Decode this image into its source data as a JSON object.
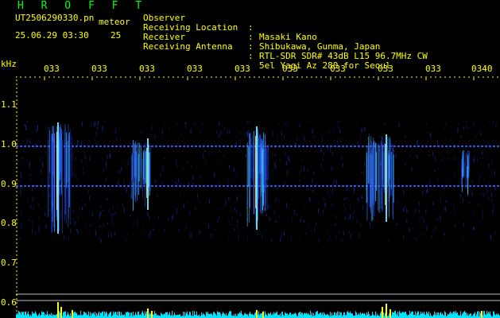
{
  "header": {
    "app_name": "H R O F F T",
    "filename": "UT2506290330.pn",
    "mode_label": "meteor",
    "datetime": "25.06.29 03:30",
    "count": "25"
  },
  "info": [
    {
      "label": "Observer",
      "sep": ":",
      "value": "Masaki Kano"
    },
    {
      "label": "Receiving Location",
      "sep": ":",
      "value": "Shibukawa, Gunma, Japan"
    },
    {
      "label": "Receiver",
      "sep": ":",
      "value": "RTL-SDR SDR# 43dB L15 96.7MHz CW"
    },
    {
      "label": "Receiving Antenna",
      "sep": ":",
      "value": "5el Yagi Az 280 for Seoul"
    }
  ],
  "y_axis": {
    "unit": "kHz",
    "ticks": [
      "1.1",
      "1.0",
      "0.9",
      "0.8",
      "0.7",
      "0.6"
    ]
  },
  "x_axis": {
    "ticks": [
      "033",
      "033",
      "033",
      "033",
      "033",
      "033",
      "033",
      "033",
      "033",
      "0340"
    ]
  },
  "colors": {
    "background": "#000000",
    "axis": "#ffff00",
    "title": "#00ff00",
    "spectrum": "#1e3ad8",
    "trace": "#00e5ff",
    "trace_peak": "#ffff00"
  }
}
